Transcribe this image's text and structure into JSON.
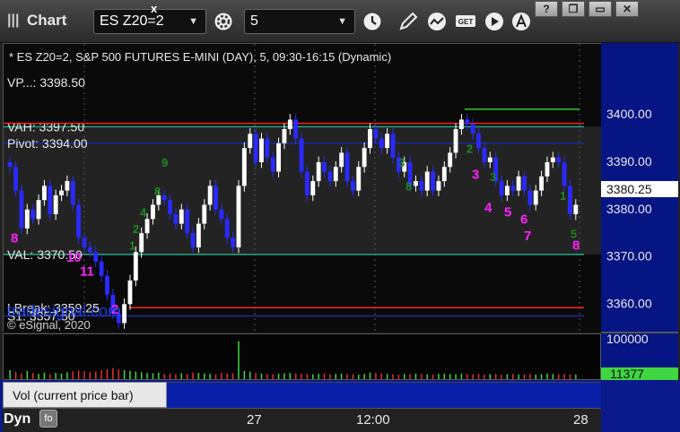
{
  "window": {
    "grip": "|||",
    "title": "Chart",
    "symbol": "ES Z20=2",
    "interval": "5"
  },
  "toolbar": {
    "icons": [
      "gear-icon",
      "clock-icon",
      "pencil-icon",
      "study-icon",
      "get-icon",
      "play-icon",
      "cursor-icon"
    ],
    "window_buttons": [
      "?",
      "❐",
      "▭",
      "✕"
    ]
  },
  "chart_header": "* ES Z20=2, S&P 500 FUTURES E-MINI (DAY), 5, 09:30-16:15 (Dynamic)",
  "watermark": "© eSignal, 2020",
  "site_label": "tradesignal.com",
  "vol_panel": {
    "tab_label": "Vol (current price bar)",
    "close": "x",
    "axis_top": "100000",
    "current_value": "11377"
  },
  "bottom": {
    "dyn_label": "Dyn",
    "icon_label": "fo"
  },
  "colors": {
    "up": "#ffffff",
    "down": "#2a2aff",
    "buy_count": "#1f8a1f",
    "sell_count": "#ff22ff",
    "resistance": "#ff2020",
    "level_line": "#22aa88",
    "pivot_line": "#1a2aa0",
    "axis_bg": "#051583"
  },
  "chart_data": {
    "type": "candlestick",
    "title": "* ES Z20=2, S&P 500 FUTURES E-MINI (DAY), 5, 09:30-16:15 (Dynamic)",
    "y_ticks": [
      "3400.00",
      "3390.00",
      "3380.00",
      "3370.00",
      "3360.00"
    ],
    "ylim": [
      3354,
      3415
    ],
    "x_ticks": [
      "27",
      "12:00",
      "28"
    ],
    "current_price": "3380.25",
    "levels": [
      {
        "name": "VAH",
        "label": "VAH: 3397.50",
        "value": 3397.5
      },
      {
        "name": "Pivot",
        "label": "Pivot: 3394.00",
        "value": 3394.0
      },
      {
        "name": "VAL",
        "label": "VAL: 3370.50",
        "value": 3370.5
      },
      {
        "name": "LBreak",
        "label": "LBreak: 3359.25",
        "value": 3359.25
      },
      {
        "name": "S1",
        "label": "S1: 3357.50",
        "value": 3357.5
      }
    ],
    "partial_label": "VP...: 3398.50",
    "sell_counts": [
      "8",
      "10",
      "11",
      "2",
      "3",
      "4",
      "5",
      "6",
      "7",
      "8"
    ],
    "buy_counts": [
      "9",
      "8",
      "4",
      "2",
      "1",
      "3",
      "8",
      "2",
      "3",
      "1",
      "5"
    ],
    "closes": [
      3389,
      3384,
      3376,
      3380,
      3378,
      3382,
      3385,
      3379,
      3383,
      3384,
      3386,
      3381,
      3374,
      3372,
      3371,
      3369,
      3366,
      3362,
      3358,
      3356,
      3360,
      3365,
      3371,
      3375,
      3378,
      3381,
      3383,
      3382,
      3379,
      3377,
      3380,
      3375,
      3372,
      3377,
      3381,
      3385,
      3380,
      3378,
      3374,
      3372,
      3385,
      3393,
      3396,
      3390,
      3395,
      3391,
      3388,
      3394,
      3397,
      3399,
      3395,
      3388,
      3383,
      3386,
      3390,
      3388,
      3386,
      3389,
      3392,
      3386,
      3384,
      3389,
      3393,
      3397,
      3395,
      3393,
      3396,
      3391,
      3388,
      3390,
      3385,
      3386,
      3384,
      3388,
      3384,
      3386,
      3389,
      3392,
      3397,
      3399,
      3398,
      3396,
      3393,
      3390,
      3391,
      3386,
      3383,
      3385,
      3384,
      3387,
      3384,
      3381,
      3384,
      3387,
      3390,
      3391,
      3390,
      3385,
      3379,
      3381
    ],
    "volumes": [
      2600,
      2100,
      1700,
      2400,
      1800,
      1500,
      1900,
      1400,
      1800,
      1600,
      2000,
      2200,
      2500,
      2300,
      2000,
      2200,
      2600,
      2900,
      3200,
      2800,
      2600,
      2400,
      2200,
      2000,
      1800,
      1700,
      1900,
      1500,
      1600,
      1400,
      1700,
      1500,
      1900,
      1800,
      1600,
      1500,
      1400,
      1800,
      1600,
      1700,
      2000,
      2400,
      2200,
      1800,
      1600,
      1500,
      1400,
      1600,
      1700,
      1800,
      1700,
      1600,
      1500,
      1400,
      1500,
      1600,
      1400,
      1500,
      1600,
      1500,
      1400,
      1300,
      1500,
      1900,
      1800,
      1600,
      1500,
      1400,
      1300,
      1500,
      1400,
      1600,
      1500,
      1400,
      1300,
      1500,
      1600,
      1500,
      1400,
      1600,
      1500,
      1400,
      1500,
      1300,
      1400,
      1500,
      1300,
      1400,
      1500,
      1300,
      1400,
      1500,
      1300,
      1400,
      1600,
      1500,
      1400,
      1500,
      1400,
      1300
    ],
    "volume_spike_index": 40,
    "volume_spike": 11000,
    "current_volume": 11377
  }
}
